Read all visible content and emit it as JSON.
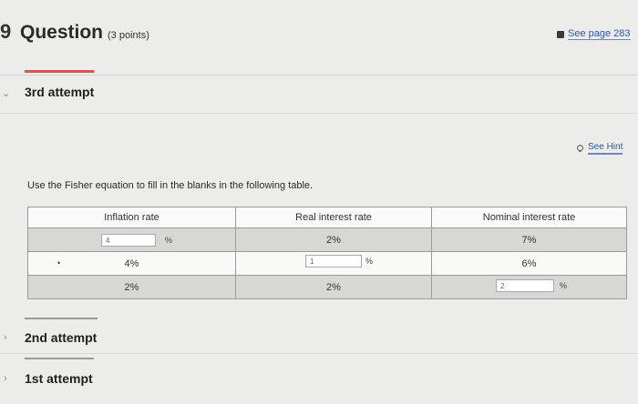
{
  "header": {
    "number": "9",
    "title": "Question",
    "points": "(3 points)",
    "see_page": "See page 283"
  },
  "attempts": {
    "third": "3rd attempt",
    "second": "2nd attempt",
    "first": "1st attempt"
  },
  "hint": {
    "label": "See Hint"
  },
  "instruction": "Use the Fisher equation to fill in the blanks in the following table.",
  "table": {
    "headers": [
      "Inflation rate",
      "Real interest rate",
      "Nominal interest rate"
    ],
    "rows": [
      {
        "inflation_input": "4",
        "inflation_unit": "%",
        "real": "2%",
        "nominal": "7%"
      },
      {
        "bullet": "•",
        "inflation": "4%",
        "real_input": "1",
        "real_unit": "%",
        "nominal": "6%"
      },
      {
        "inflation": "2%",
        "real": "2%",
        "nominal_input": "2",
        "nominal_unit": "%"
      }
    ]
  },
  "colors": {
    "link": "#2f57a8",
    "accent_bar": "#d9534f",
    "row_gray": "#d7d7d5"
  }
}
